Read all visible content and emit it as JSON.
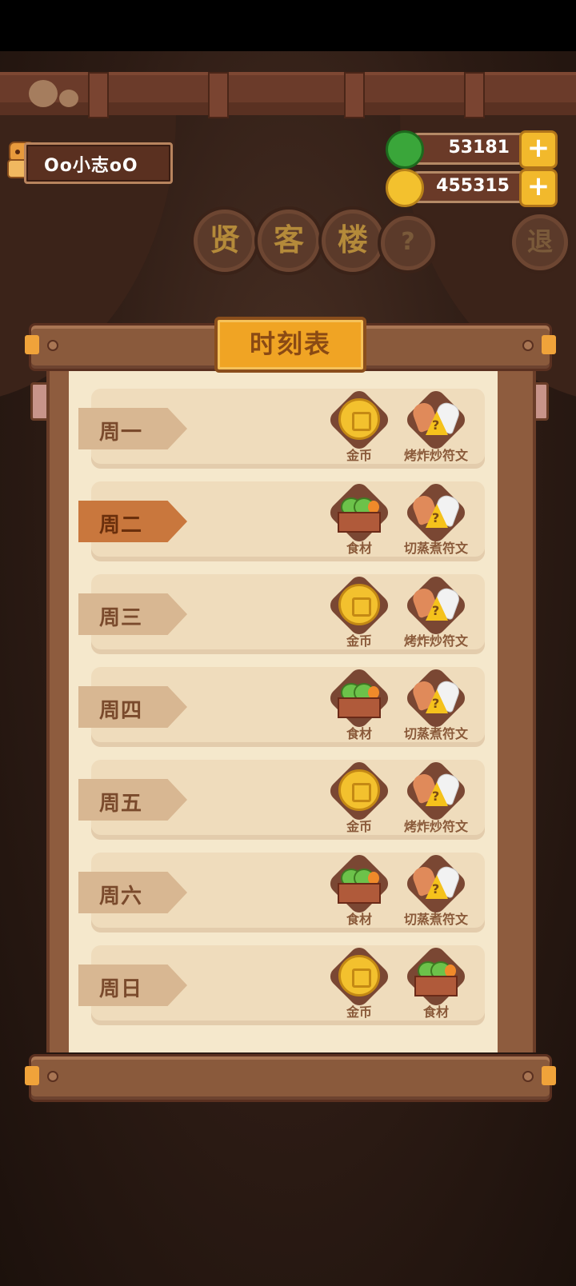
{
  "player": {
    "name": "Oo小志oO"
  },
  "resources": [
    {
      "name": "jade",
      "value": "53181",
      "icon": "green-jade-icon",
      "color": "#3aa63a"
    },
    {
      "name": "gold",
      "value": "455315",
      "icon": "gold-coin-icon",
      "color": "#f3c12e"
    }
  ],
  "title_chars": [
    "贤",
    "客",
    "楼"
  ],
  "help_symbol": "?",
  "exit_label": "退",
  "timetable": {
    "title": "时刻表",
    "rows": [
      {
        "day": "周一",
        "active": false,
        "rewards": [
          {
            "label": "金币",
            "icon": "coin"
          },
          {
            "label": "烤炸炒符文",
            "icon": "rune"
          }
        ]
      },
      {
        "day": "周二",
        "active": true,
        "rewards": [
          {
            "label": "食材",
            "icon": "food"
          },
          {
            "label": "切蒸煮符文",
            "icon": "rune"
          }
        ]
      },
      {
        "day": "周三",
        "active": false,
        "rewards": [
          {
            "label": "金币",
            "icon": "coin"
          },
          {
            "label": "烤炸炒符文",
            "icon": "rune"
          }
        ]
      },
      {
        "day": "周四",
        "active": false,
        "rewards": [
          {
            "label": "食材",
            "icon": "food"
          },
          {
            "label": "切蒸煮符文",
            "icon": "rune"
          }
        ]
      },
      {
        "day": "周五",
        "active": false,
        "rewards": [
          {
            "label": "金币",
            "icon": "coin"
          },
          {
            "label": "烤炸炒符文",
            "icon": "rune"
          }
        ]
      },
      {
        "day": "周六",
        "active": false,
        "rewards": [
          {
            "label": "食材",
            "icon": "food"
          },
          {
            "label": "切蒸煮符文",
            "icon": "rune"
          }
        ]
      },
      {
        "day": "周日",
        "active": false,
        "rewards": [
          {
            "label": "金币",
            "icon": "coin"
          },
          {
            "label": "食材",
            "icon": "food"
          }
        ]
      }
    ]
  },
  "colors": {
    "accent": "#f0a424",
    "active_tag": "#c9773d",
    "tag": "#d8b792",
    "paper": "#f5e8cc"
  }
}
